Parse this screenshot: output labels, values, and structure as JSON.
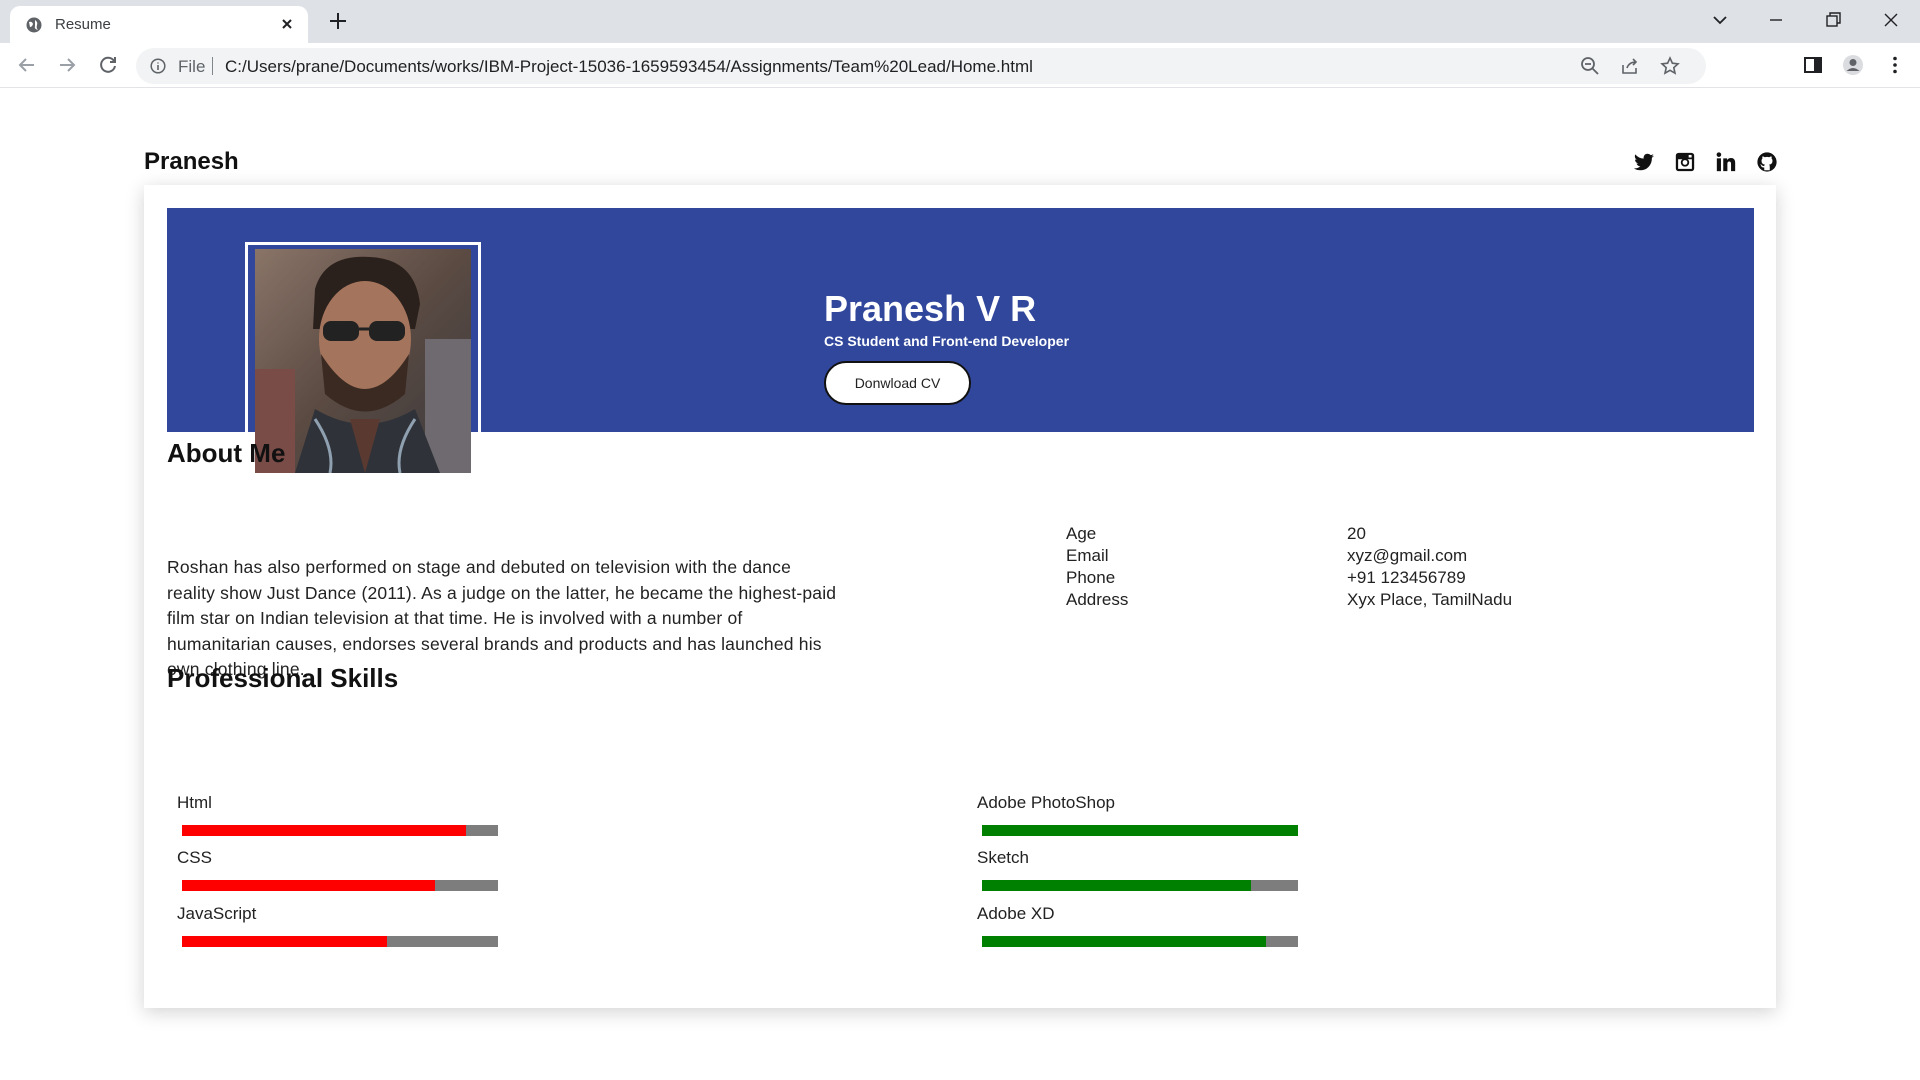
{
  "browser": {
    "tab_title": "Resume",
    "file_label": "File",
    "url": "C:/Users/prane/Documents/works/IBM-Project-15036-1659593454/Assignments/Team%20Lead/Home.html"
  },
  "page": {
    "brand": "Pranesh",
    "social_icons": [
      "twitter-icon",
      "instagram-icon",
      "linkedin-icon",
      "github-icon"
    ]
  },
  "hero": {
    "name": "Pranesh V R",
    "role": "CS Student and Front-end Developer",
    "cv_button": "Donwload CV",
    "background": "#30479c"
  },
  "about": {
    "title": "About Me",
    "text": "Roshan has also performed on stage and debuted on television with the dance reality show Just Dance (2011). As a judge on the latter, he became the highest-paid film star on Indian television at that time. He is involved with a number of humanitarian causes, endorses several brands and products and has launched his own clothing line."
  },
  "info": [
    {
      "label": "Age",
      "value": "20"
    },
    {
      "label": "Email",
      "value": "xyz@gmail.com"
    },
    {
      "label": "Phone",
      "value": "+91 123456789"
    },
    {
      "label": "Address",
      "value": "Xyx Place, TamilNadu"
    }
  ],
  "skills": {
    "title": "Professional Skills",
    "left": [
      {
        "name": "Html",
        "level": 0.9
      },
      {
        "name": "CSS",
        "level": 0.8
      },
      {
        "name": "JavaScript",
        "level": 0.65
      }
    ],
    "right": [
      {
        "name": "Adobe PhotoShop",
        "level": 1.0
      },
      {
        "name": "Sketch",
        "level": 0.85
      },
      {
        "name": "Adobe XD",
        "level": 0.9
      }
    ],
    "left_color": "#ff0000",
    "right_color": "#008000",
    "track_color": "#7d7d7d"
  }
}
